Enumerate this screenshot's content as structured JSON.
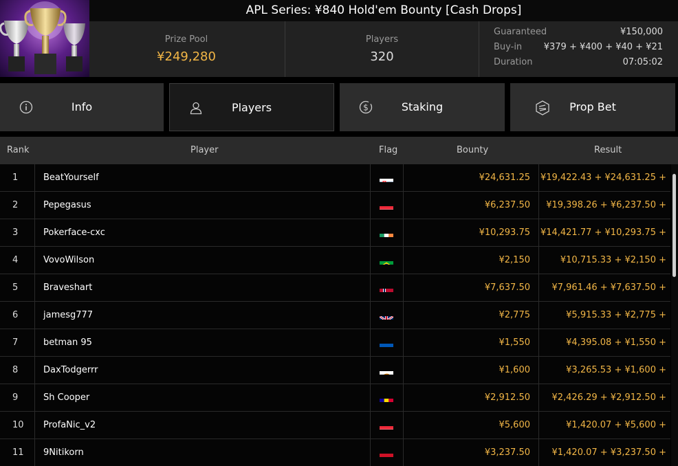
{
  "header": {
    "title": "APL Series: ¥840 Hold'em Bounty [Cash Drops]"
  },
  "stats": {
    "prize_pool_label": "Prize Pool",
    "prize_pool_value": "¥249,280",
    "players_label": "Players",
    "players_value": "320",
    "details": [
      {
        "label": "Guaranteed",
        "value": "¥150,000"
      },
      {
        "label": "Buy-in",
        "value": "¥379 + ¥400 + ¥40 + ¥21"
      },
      {
        "label": "Duration",
        "value": "07:05:02"
      }
    ]
  },
  "tabs": [
    {
      "label": "Info",
      "icon": "info-icon"
    },
    {
      "label": "Players",
      "icon": "user-icon"
    },
    {
      "label": "Staking",
      "icon": "coin-dollar-icon"
    },
    {
      "label": "Prop Bet",
      "icon": "poker-chip-icon"
    }
  ],
  "active_tab": "Players",
  "table": {
    "headers": {
      "rank": "Rank",
      "player": "Player",
      "flag": "Flag",
      "bounty": "Bounty",
      "result": "Result"
    },
    "rows": [
      {
        "rank": "1",
        "player": "BeatYourself",
        "flag": "slovakia",
        "bounty": "¥24,631.25",
        "result": "¥19,422.43 + ¥24,631.25 +"
      },
      {
        "rank": "2",
        "player": "Pepegasus",
        "flag": "austria",
        "bounty": "¥6,237.50",
        "result": "¥19,398.26 + ¥6,237.50 +"
      },
      {
        "rank": "3",
        "player": "Pokerface-cxc",
        "flag": "ireland",
        "bounty": "¥10,293.75",
        "result": "¥14,421.77 + ¥10,293.75 +"
      },
      {
        "rank": "4",
        "player": "VovoWilson",
        "flag": "brazil",
        "bounty": "¥2,150",
        "result": "¥10,715.33 + ¥2,150 +"
      },
      {
        "rank": "5",
        "player": "Braveshart",
        "flag": "norway",
        "bounty": "¥7,637.50",
        "result": "¥7,961.46 + ¥7,637.50 +"
      },
      {
        "rank": "6",
        "player": "jamesg777",
        "flag": "united-kingdom",
        "bounty": "¥2,775",
        "result": "¥5,915.33 + ¥2,775 +"
      },
      {
        "rank": "7",
        "player": "betman 95",
        "flag": "ukraine",
        "bounty": "¥1,550",
        "result": "¥4,395.08 + ¥1,550 +"
      },
      {
        "rank": "8",
        "player": "DaxTodgerrr",
        "flag": "cyprus",
        "bounty": "¥1,600",
        "result": "¥3,265.53 + ¥1,600 +"
      },
      {
        "rank": "9",
        "player": "Sh Cooper",
        "flag": "andorra",
        "bounty": "¥2,912.50",
        "result": "¥2,426.29 + ¥2,912.50 +"
      },
      {
        "rank": "10",
        "player": "ProfaNic_v2",
        "flag": "austria",
        "bounty": "¥5,600",
        "result": "¥1,420.07 + ¥5,600 +"
      },
      {
        "rank": "11",
        "player": "9Nitikorn",
        "flag": "indonesia",
        "bounty": "¥3,237.50",
        "result": "¥1,420.07 + ¥3,237.50 +"
      }
    ]
  },
  "colors": {
    "accent_gold": "#f2b646",
    "background": "#000000",
    "panel": "#222222",
    "tab": "#2d2d2d"
  }
}
